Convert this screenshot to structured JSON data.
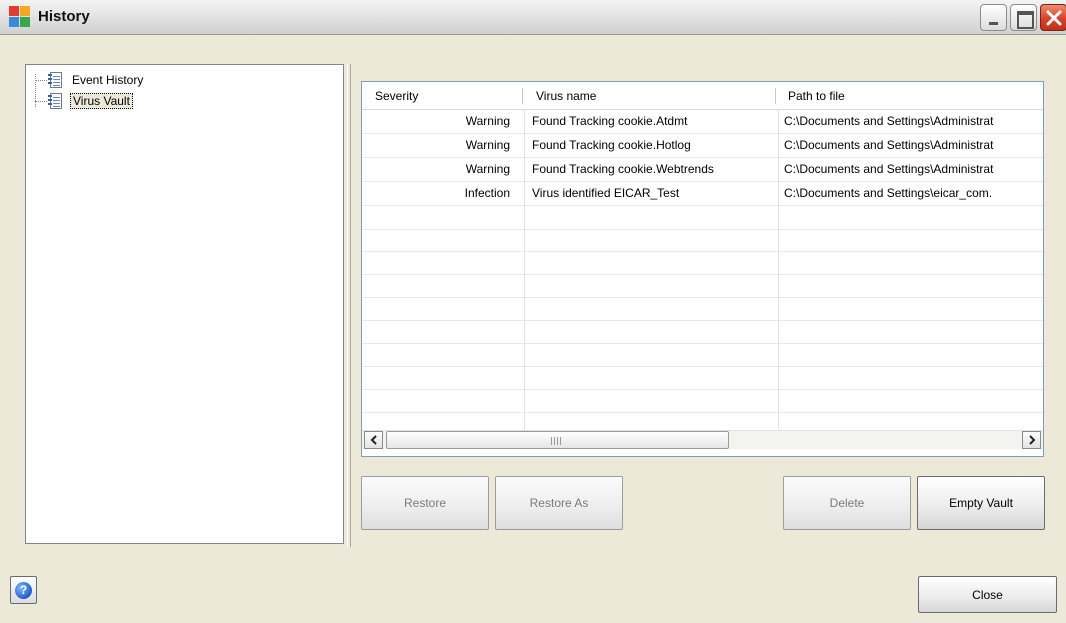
{
  "window": {
    "title": "History",
    "controls": [
      "minimize-icon",
      "maximize-icon",
      "close-icon"
    ]
  },
  "tree": {
    "items": [
      {
        "label": "Event History",
        "icon": "document-icon",
        "selected": false
      },
      {
        "label": "Virus Vault",
        "icon": "document-icon",
        "selected": true
      }
    ]
  },
  "table": {
    "columns": [
      "Severity",
      "Virus name",
      "Path to file"
    ],
    "rows": [
      [
        "Warning",
        "Found Tracking cookie.Atdmt",
        "C:\\Documents and Settings\\Administrat"
      ],
      [
        "Warning",
        "Found Tracking cookie.Hotlog",
        "C:\\Documents and Settings\\Administrat"
      ],
      [
        "Warning",
        "Found Tracking cookie.Webtrends",
        "C:\\Documents and Settings\\Administrat"
      ],
      [
        "Infection",
        "Virus identified EICAR_Test",
        "C:\\Documents and Settings\\eicar_com."
      ]
    ]
  },
  "buttons": {
    "restore": "Restore",
    "restore_as": "Restore As",
    "delete": "Delete",
    "empty_vault": "Empty Vault",
    "close": "Close"
  },
  "colors": {
    "selection_bg": "#ece9d8",
    "dialog_bg": "#ece9d8",
    "close_red": "#d8432a"
  }
}
